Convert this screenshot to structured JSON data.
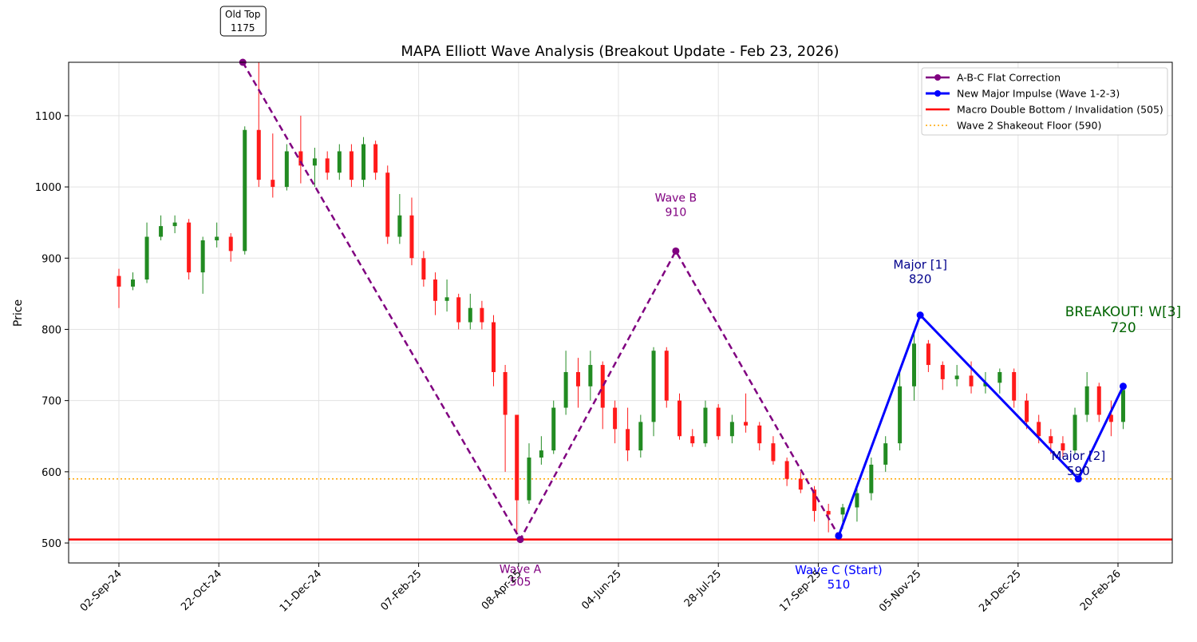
{
  "chart_data": {
    "type": "candlestick",
    "title": "MAPA Elliott Wave Analysis (Breakout Update - Feb 23, 2026)",
    "xlabel": "",
    "ylabel": "Price",
    "ylim": [
      472,
      1175
    ],
    "y_ticks": [
      500,
      600,
      700,
      800,
      900,
      1000,
      1100
    ],
    "x_ticks": [
      "02-Sep-24",
      "22-Oct-24",
      "11-Dec-24",
      "07-Feb-25",
      "08-Apr-25",
      "04-Jun-25",
      "28-Jul-25",
      "17-Sep-25",
      "05-Nov-25",
      "24-Dec-25",
      "20-Feb-26"
    ],
    "grid": true,
    "legend_position": "top-right",
    "colors": {
      "up": "#228b22",
      "down": "#ff1a1a",
      "abc": "#800080",
      "impulse": "#0000ff",
      "invalidation": "#ff0000",
      "shakeout": "#ffa500",
      "major_label": "#00008b",
      "breakout_label": "#006400"
    },
    "candles": [
      [
        "2024-09-02",
        875,
        885,
        830,
        860
      ],
      [
        "2024-09-09",
        860,
        880,
        855,
        870
      ],
      [
        "2024-09-16",
        870,
        950,
        865,
        930
      ],
      [
        "2024-09-23",
        930,
        960,
        925,
        945
      ],
      [
        "2024-09-30",
        945,
        960,
        935,
        950
      ],
      [
        "2024-10-07",
        950,
        955,
        870,
        880
      ],
      [
        "2024-10-14",
        880,
        930,
        850,
        925
      ],
      [
        "2024-10-21",
        925,
        950,
        915,
        930
      ],
      [
        "2024-10-28",
        930,
        935,
        895,
        910
      ],
      [
        "2024-11-04",
        910,
        1085,
        905,
        1080
      ],
      [
        "2024-11-11",
        1080,
        1175,
        1000,
        1010
      ],
      [
        "2024-11-18",
        1010,
        1075,
        985,
        1000
      ],
      [
        "2024-11-25",
        1000,
        1060,
        995,
        1050
      ],
      [
        "2024-12-02",
        1050,
        1100,
        1005,
        1030
      ],
      [
        "2024-12-09",
        1030,
        1055,
        1000,
        1040
      ],
      [
        "2024-12-16",
        1040,
        1050,
        1010,
        1020
      ],
      [
        "2024-12-23",
        1020,
        1060,
        1010,
        1050
      ],
      [
        "2024-12-30",
        1050,
        1060,
        1000,
        1010
      ],
      [
        "2025-01-06",
        1010,
        1070,
        1000,
        1060
      ],
      [
        "2025-01-13",
        1060,
        1065,
        1010,
        1020
      ],
      [
        "2025-01-20",
        1020,
        1030,
        920,
        930
      ],
      [
        "2025-01-27",
        930,
        990,
        920,
        960
      ],
      [
        "2025-02-03",
        960,
        985,
        890,
        900
      ],
      [
        "2025-02-10",
        900,
        910,
        860,
        870
      ],
      [
        "2025-02-17",
        870,
        880,
        820,
        840
      ],
      [
        "2025-02-24",
        840,
        870,
        825,
        845
      ],
      [
        "2025-03-03",
        845,
        850,
        800,
        810
      ],
      [
        "2025-03-10",
        810,
        850,
        800,
        830
      ],
      [
        "2025-03-17",
        830,
        840,
        800,
        810
      ],
      [
        "2025-03-24",
        810,
        820,
        720,
        740
      ],
      [
        "2025-03-31",
        740,
        750,
        600,
        680
      ],
      [
        "2025-04-07",
        680,
        680,
        515,
        560
      ],
      [
        "2025-04-14",
        560,
        640,
        555,
        620
      ],
      [
        "2025-04-21",
        620,
        650,
        610,
        630
      ],
      [
        "2025-04-28",
        630,
        700,
        625,
        690
      ],
      [
        "2025-05-05",
        690,
        770,
        680,
        740
      ],
      [
        "2025-05-12",
        740,
        760,
        690,
        720
      ],
      [
        "2025-05-19",
        720,
        770,
        700,
        750
      ],
      [
        "2025-05-26",
        750,
        755,
        660,
        690
      ],
      [
        "2025-06-02",
        690,
        700,
        640,
        660
      ],
      [
        "2025-06-09",
        660,
        690,
        615,
        630
      ],
      [
        "2025-06-16",
        630,
        680,
        620,
        670
      ],
      [
        "2025-06-23",
        670,
        775,
        650,
        770
      ],
      [
        "2025-06-30",
        770,
        775,
        690,
        700
      ],
      [
        "2025-07-07",
        700,
        710,
        645,
        650
      ],
      [
        "2025-07-14",
        650,
        660,
        635,
        640
      ],
      [
        "2025-07-21",
        640,
        700,
        635,
        690
      ],
      [
        "2025-07-28",
        690,
        695,
        645,
        650
      ],
      [
        "2025-08-04",
        650,
        680,
        640,
        670
      ],
      [
        "2025-08-11",
        670,
        710,
        655,
        665
      ],
      [
        "2025-08-18",
        665,
        670,
        630,
        640
      ],
      [
        "2025-08-25",
        640,
        650,
        610,
        615
      ],
      [
        "2025-09-01",
        615,
        620,
        580,
        590
      ],
      [
        "2025-09-08",
        590,
        600,
        570,
        575
      ],
      [
        "2025-09-15",
        575,
        580,
        530,
        545
      ],
      [
        "2025-09-22",
        545,
        555,
        515,
        540
      ],
      [
        "2025-09-29",
        540,
        555,
        520,
        550
      ],
      [
        "2025-10-06",
        550,
        580,
        530,
        570
      ],
      [
        "2025-10-13",
        570,
        620,
        560,
        610
      ],
      [
        "2025-10-20",
        610,
        650,
        600,
        640
      ],
      [
        "2025-10-27",
        640,
        740,
        630,
        720
      ],
      [
        "2025-11-03",
        720,
        795,
        700,
        780
      ],
      [
        "2025-11-10",
        780,
        785,
        740,
        750
      ],
      [
        "2025-11-17",
        750,
        755,
        715,
        730
      ],
      [
        "2025-11-24",
        730,
        750,
        720,
        735
      ],
      [
        "2025-12-01",
        735,
        755,
        710,
        720
      ],
      [
        "2025-12-08",
        720,
        740,
        710,
        725
      ],
      [
        "2025-12-15",
        725,
        745,
        710,
        740
      ],
      [
        "2025-12-22",
        740,
        745,
        690,
        700
      ],
      [
        "2025-12-29",
        700,
        710,
        660,
        670
      ],
      [
        "2026-01-05",
        670,
        680,
        640,
        650
      ],
      [
        "2026-01-12",
        650,
        660,
        625,
        640
      ],
      [
        "2026-01-19",
        640,
        650,
        620,
        630
      ],
      [
        "2026-01-26",
        630,
        690,
        625,
        680
      ],
      [
        "2026-02-02",
        680,
        740,
        670,
        720
      ],
      [
        "2026-02-09",
        720,
        725,
        670,
        680
      ],
      [
        "2026-02-16",
        680,
        700,
        650,
        670
      ],
      [
        "2026-02-23",
        670,
        720,
        660,
        715
      ]
    ],
    "series": [
      {
        "name": "A-B-C Flat Correction",
        "style": "dashed-with-markers",
        "points": [
          [
            "2024-11-03",
            1175
          ],
          [
            "2025-04-09",
            505
          ],
          [
            "2025-07-05",
            910
          ],
          [
            "2025-09-27",
            510
          ]
        ]
      },
      {
        "name": "New Major Impulse (Wave 1-2-3)",
        "style": "solid-with-markers",
        "points": [
          [
            "2025-09-27",
            510
          ],
          [
            "2025-11-06",
            820
          ],
          [
            "2026-01-28",
            590
          ],
          [
            "2026-02-23",
            720
          ]
        ]
      }
    ],
    "hlines": [
      {
        "name": "Macro Double Bottom / Invalidation (505)",
        "y": 505,
        "style": "solid"
      },
      {
        "name": "Wave 2 Shakeout Floor (590)",
        "y": 590,
        "style": "dotted"
      }
    ],
    "annotations": [
      {
        "key": "oldtop",
        "text": "Old Top",
        "value": "1175",
        "date": "2024-11-03",
        "y": 1175
      },
      {
        "key": "a",
        "text": "Wave A",
        "value": "505",
        "date": "2025-04-09",
        "y": 505
      },
      {
        "key": "b",
        "text": "Wave B",
        "value": "910",
        "date": "2025-07-05",
        "y": 910
      },
      {
        "key": "c",
        "text": "Wave C (Start)",
        "value": "510",
        "date": "2025-09-27",
        "y": 510
      },
      {
        "key": "m1",
        "text": "Major [1]",
        "value": "820",
        "date": "2025-11-06",
        "y": 820
      },
      {
        "key": "m2",
        "text": "Major [2]",
        "value": "590",
        "date": "2026-01-28",
        "y": 590
      },
      {
        "key": "w3",
        "text": "BREAKOUT! W[3]",
        "value": "720",
        "date": "2026-02-23",
        "y": 720
      }
    ]
  }
}
